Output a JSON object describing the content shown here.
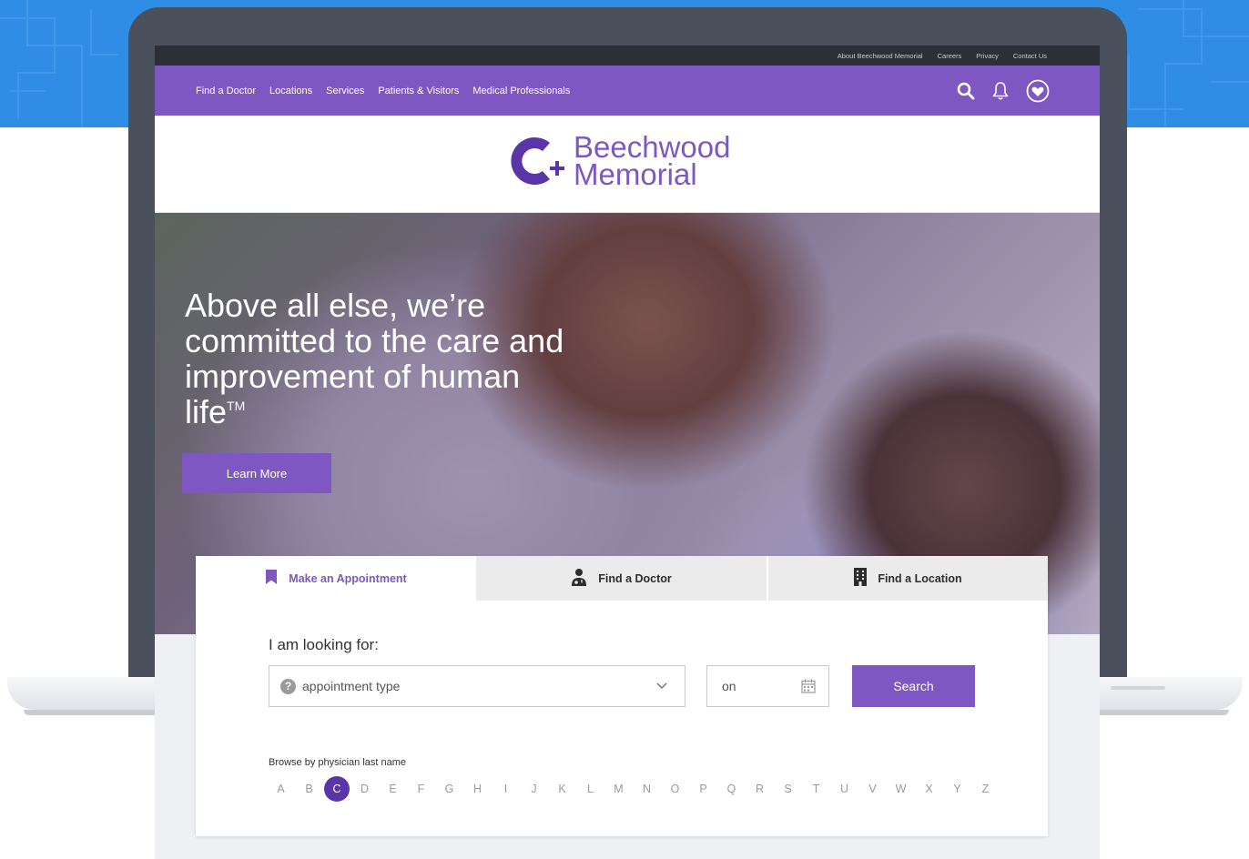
{
  "brand": {
    "accent": "#7e57c2",
    "accent_dark": "#5b35a8",
    "utility_bar": "#2c2f36",
    "name_line1": "Beechwood",
    "name_line2": "Memorial"
  },
  "utility_links": [
    "About Beechwood Memorial",
    "Careers",
    "Privacy",
    "Contact Us"
  ],
  "main_nav": [
    "Find a Doctor",
    "Locations",
    "Services",
    "Patients & Visitors",
    "Medical Professionals"
  ],
  "nav_icons": [
    "search-icon",
    "bell-icon",
    "heart-circle-icon"
  ],
  "hero": {
    "title": "Above all else, we’re committed to the care and improvement  of human life",
    "trademark": "TM",
    "cta": "Learn More"
  },
  "tabs": [
    {
      "label": "Make an Appointment",
      "icon": "bookmark-icon",
      "active": true
    },
    {
      "label": "Find a Doctor",
      "icon": "doctor-icon",
      "active": false
    },
    {
      "label": "Find a Location",
      "icon": "building-icon",
      "active": false
    }
  ],
  "form": {
    "looking_label": "I am looking for:",
    "appointment_placeholder": "appointment type",
    "date_placeholder": "on",
    "search_label": "Search"
  },
  "browse": {
    "label": "Browse by physician last name",
    "letters": [
      "A",
      "B",
      "C",
      "D",
      "E",
      "F",
      "G",
      "H",
      "I",
      "J",
      "K",
      "L",
      "M",
      "N",
      "O",
      "P",
      "Q",
      "R",
      "S",
      "T",
      "U",
      "V",
      "W",
      "X",
      "Y",
      "Z"
    ],
    "selected": "C"
  }
}
